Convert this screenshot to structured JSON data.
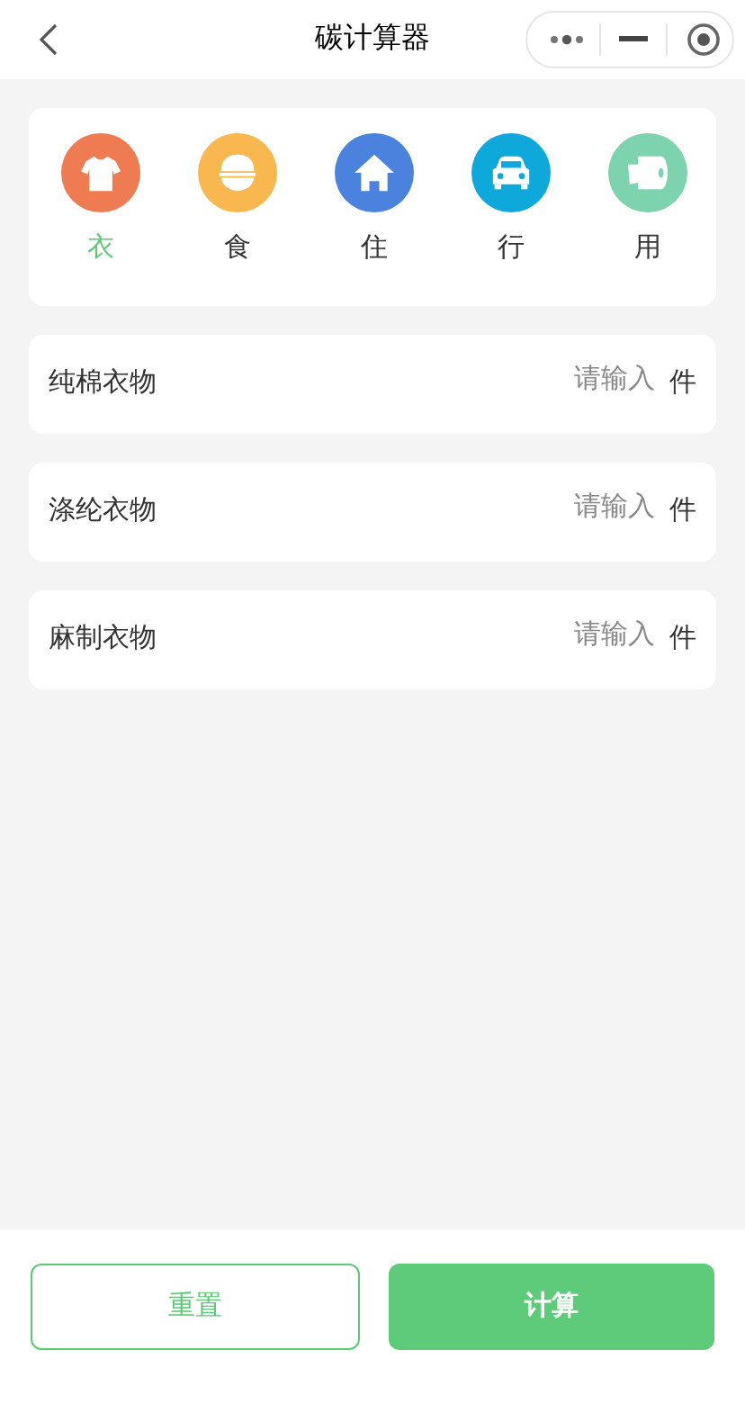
{
  "nav": {
    "title": "碳计算器"
  },
  "categories": [
    {
      "label": "衣",
      "kind": "shirt",
      "color": "#ee7b51",
      "selected": true
    },
    {
      "label": "食",
      "kind": "bowl",
      "color": "#f8b74f",
      "selected": false
    },
    {
      "label": "住",
      "kind": "house",
      "color": "#4a82de",
      "selected": false
    },
    {
      "label": "行",
      "kind": "car",
      "color": "#0ea8db",
      "selected": false
    },
    {
      "label": "用",
      "kind": "roll",
      "color": "#7dd3ae",
      "selected": false
    }
  ],
  "items": [
    {
      "label": "纯棉衣物",
      "placeholder": "请输入",
      "unit": "件"
    },
    {
      "label": "涤纶衣物",
      "placeholder": "请输入",
      "unit": "件"
    },
    {
      "label": "麻制衣物",
      "placeholder": "请输入",
      "unit": "件"
    }
  ],
  "buttons": {
    "reset": "重置",
    "calculate": "计算"
  }
}
